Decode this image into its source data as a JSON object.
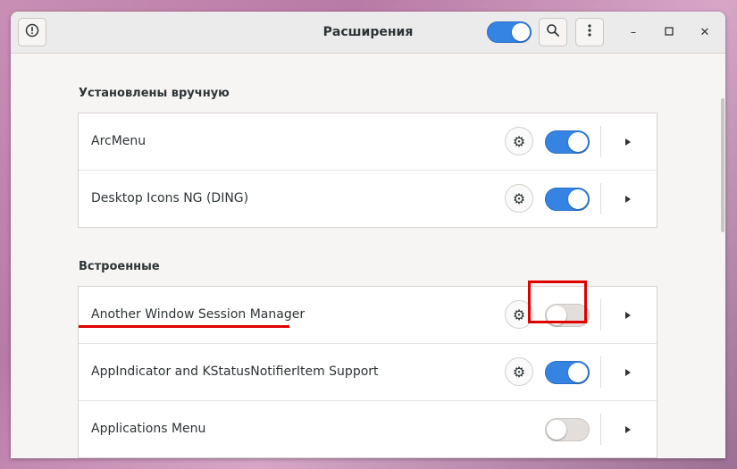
{
  "window": {
    "title": "Расширения"
  },
  "header": {
    "title": "Расширения",
    "info_icon": "exclamation-icon",
    "main_toggle_on": true,
    "search_icon": "search-icon",
    "menu_icon": "vertical-dots-icon",
    "minimize": "–",
    "maximize": "□",
    "close": "✕"
  },
  "sections": [
    {
      "title": "Установлены вручную",
      "items": [
        {
          "name": "ArcMenu",
          "has_settings": true,
          "enabled": true
        },
        {
          "name": "Desktop Icons NG (DING)",
          "has_settings": true,
          "enabled": true
        }
      ]
    },
    {
      "title": "Встроенные",
      "items": [
        {
          "name": "Another Window Session Manager",
          "has_settings": true,
          "enabled": false
        },
        {
          "name": "AppIndicator and KStatusNotifierItem Support",
          "has_settings": true,
          "enabled": true
        },
        {
          "name": "Applications Menu",
          "has_settings": false,
          "enabled": false
        }
      ]
    }
  ],
  "annotations": {
    "highlight_color": "#e00000"
  },
  "colors": {
    "accent": "#3584e4",
    "window_bg": "#f6f5f4"
  }
}
